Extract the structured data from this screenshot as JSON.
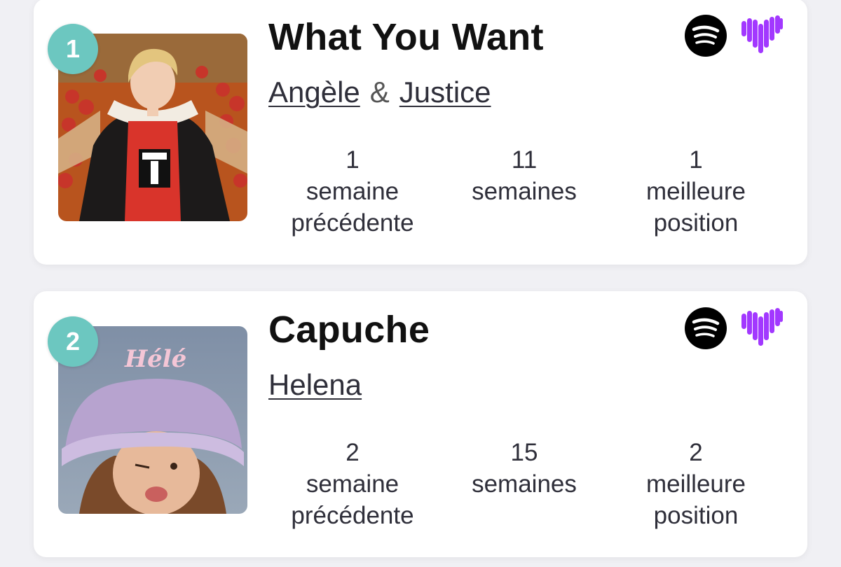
{
  "entries": [
    {
      "rank": "1",
      "title": "What You Want",
      "artists": [
        "Angèle",
        "Justice"
      ],
      "separator": "&",
      "stats": [
        {
          "value": "1",
          "label_line1": "semaine",
          "label_line2": "précédente"
        },
        {
          "value": "11",
          "label_line1": "semaines",
          "label_line2": ""
        },
        {
          "value": "1",
          "label_line1": "meilleure",
          "label_line2": "position"
        }
      ],
      "services": [
        "spotify-icon",
        "deezer-icon"
      ]
    },
    {
      "rank": "2",
      "title": "Capuche",
      "artists": [
        "Helena"
      ],
      "cover_text": "Hélé",
      "stats": [
        {
          "value": "2",
          "label_line1": "semaine",
          "label_line2": "précédente"
        },
        {
          "value": "15",
          "label_line1": "semaines",
          "label_line2": ""
        },
        {
          "value": "2",
          "label_line1": "meilleure",
          "label_line2": "position"
        }
      ],
      "services": [
        "spotify-icon",
        "deezer-icon"
      ]
    }
  ],
  "colors": {
    "badge": "#6cc7c0",
    "deezer": "#a238ff",
    "spotify": "#000000",
    "background": "#f0f0f4"
  }
}
